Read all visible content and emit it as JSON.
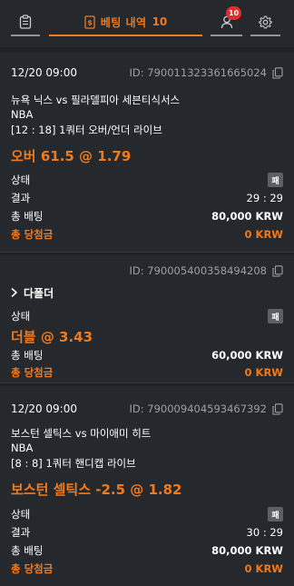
{
  "tabs": {
    "betting_history": {
      "label": "베팅 내역",
      "count": "10"
    },
    "profile": {
      "badge": "10"
    }
  },
  "bets": [
    {
      "date": "12/20 09:00",
      "id_label": "ID: 790011323361665024",
      "match": "뉴욕 닉스 vs 필라델피아 세븐티식서스",
      "league": "NBA",
      "market": "[12 : 18] 1쿼터 오버/언더 라이브",
      "pick": "오버 61.5 @ 1.79",
      "status_label": "상태",
      "status_badge": "패",
      "result_label": "결과",
      "result_value": "29 : 29",
      "total_bet_label": "총 배팅",
      "total_bet_value": "80,000 KRW",
      "total_win_label": "총 당첨금",
      "total_win_value": "0 KRW"
    },
    {
      "id_label": "ID: 790005400358494208",
      "expand_label": "다폴더",
      "status_label": "상태",
      "status_badge": "패",
      "pick": "더블 @ 3.43",
      "total_bet_label": "총 배팅",
      "total_bet_value": "60,000 KRW",
      "total_win_label": "총 당첨금",
      "total_win_value": "0 KRW"
    },
    {
      "date": "12/20 09:00",
      "id_label": "ID: 790009404593467392",
      "match": "보스턴 셀틱스 vs 마이애미 히트",
      "league": "NBA",
      "market": "[8 : 8] 1쿼터 핸디캡 라이브",
      "pick": "보스턴 셀틱스 -2.5 @ 1.82",
      "status_label": "상태",
      "status_badge": "패",
      "result_label": "결과",
      "result_value": "30 : 29",
      "total_bet_label": "총 배팅",
      "total_bet_value": "80,000 KRW",
      "total_win_label": "총 당첨금",
      "total_win_value": "0 KRW"
    }
  ],
  "colors": {
    "accent": "#f07a1c",
    "background": "#1f2226",
    "card": "#25282c",
    "badge": "#5b6067",
    "notification": "#e52b2b"
  },
  "icons": [
    "clipboard-icon",
    "receipt-icon",
    "user-icon",
    "gear-icon",
    "copy-icon",
    "chevron-right-icon"
  ]
}
